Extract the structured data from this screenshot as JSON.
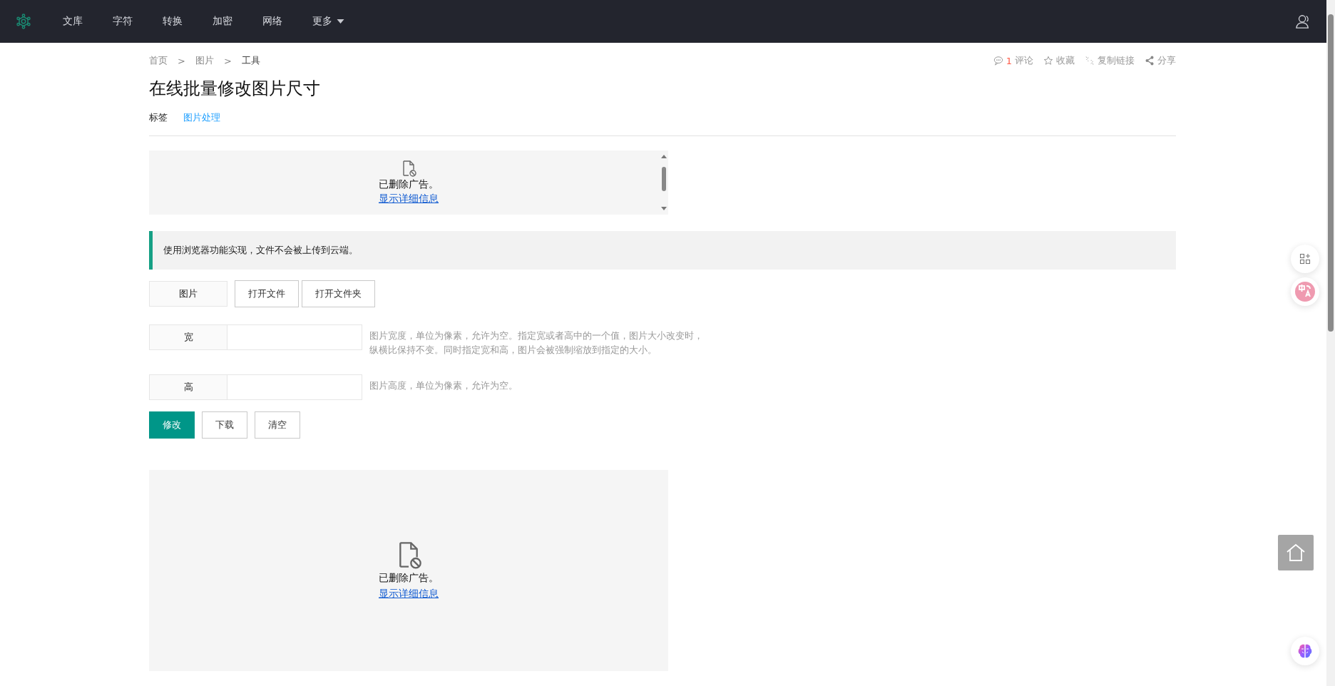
{
  "nav": {
    "items": [
      {
        "label": "文库",
        "dropdown": false
      },
      {
        "label": "字符",
        "dropdown": false
      },
      {
        "label": "转换",
        "dropdown": false
      },
      {
        "label": "加密",
        "dropdown": false
      },
      {
        "label": "网络",
        "dropdown": false
      },
      {
        "label": "更多",
        "dropdown": true
      }
    ]
  },
  "breadcrumb": {
    "items": [
      {
        "label": "首页",
        "current": false
      },
      {
        "label": "图片",
        "current": false
      },
      {
        "label": "工具",
        "current": true
      }
    ],
    "separators": [
      ">",
      ">"
    ]
  },
  "actions": [
    {
      "kind": "comment",
      "count": "1",
      "label": "评论"
    },
    {
      "kind": "star",
      "label": "收藏"
    },
    {
      "kind": "link",
      "label": "复制链接"
    },
    {
      "kind": "share",
      "label": "分享"
    }
  ],
  "title": "在线批量修改图片尺寸",
  "tags": {
    "label": "标签",
    "items": [
      "图片处理"
    ]
  },
  "ads": [
    {
      "kind": "small",
      "text": "已删除广告。",
      "link": "显示详细信息"
    },
    {
      "kind": "large",
      "text": "已删除广告。",
      "link": "显示详细信息"
    }
  ],
  "notice": "使用浏览器功能实现，文件不会被上传到云端。",
  "form": {
    "image": {
      "label": "图片",
      "buttons": [
        "打开文件",
        "打开文件夹"
      ]
    },
    "fields": [
      {
        "label": "宽",
        "hint": "图片宽度，单位为像素，允许为空。指定宽或者高中的一个值，图片大小改变时，纵横比保持不变。同时指定宽和高，图片会被强制缩放到指定的大小。"
      },
      {
        "label": "高",
        "hint": "图片高度，单位为像素，允许为空。"
      }
    ],
    "buttons": [
      {
        "label": "修改",
        "primary": true
      },
      {
        "label": "下载",
        "primary": false
      },
      {
        "label": "清空",
        "primary": false
      }
    ]
  }
}
